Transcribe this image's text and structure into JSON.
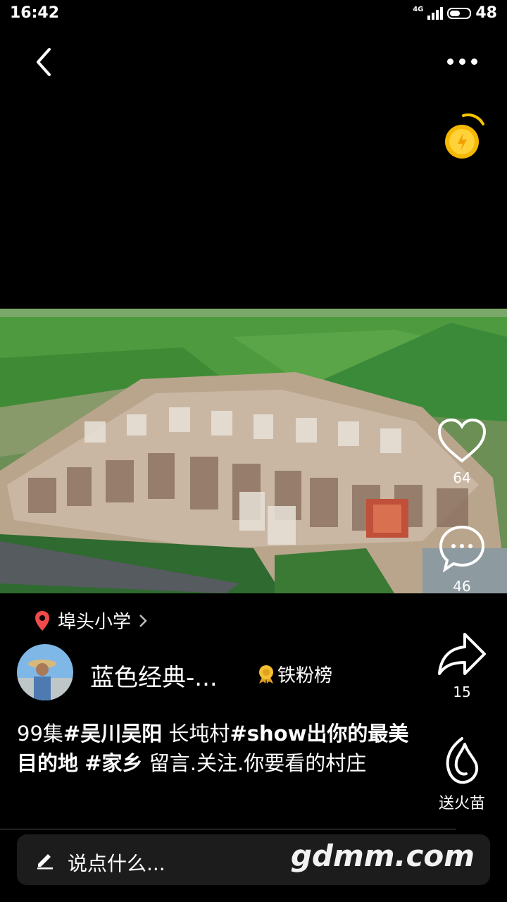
{
  "status_bar": {
    "time": "16:42",
    "network": "4G",
    "battery": "48"
  },
  "location": {
    "name": "埠头小学"
  },
  "author": {
    "name": "蓝色经典-...",
    "badge": "铁粉榜"
  },
  "actions": {
    "likes": "64",
    "comments": "46",
    "shares": "15",
    "gift_label": "送火苗"
  },
  "caption": {
    "p1": "99集",
    "tag1": "#吴川吴阳",
    "p2": "  长坉村",
    "tag2": "#show出你的最美目的地",
    "p3": " ",
    "tag3": "#家乡",
    "p4": " 留言.关注.你要看的村庄"
  },
  "input": {
    "placeholder": "说点什么..."
  },
  "watermark": "gdmm.com",
  "colors": {
    "location_pin": "#f04a4a",
    "coin": "#f5b800",
    "badge": "#f3c033"
  }
}
